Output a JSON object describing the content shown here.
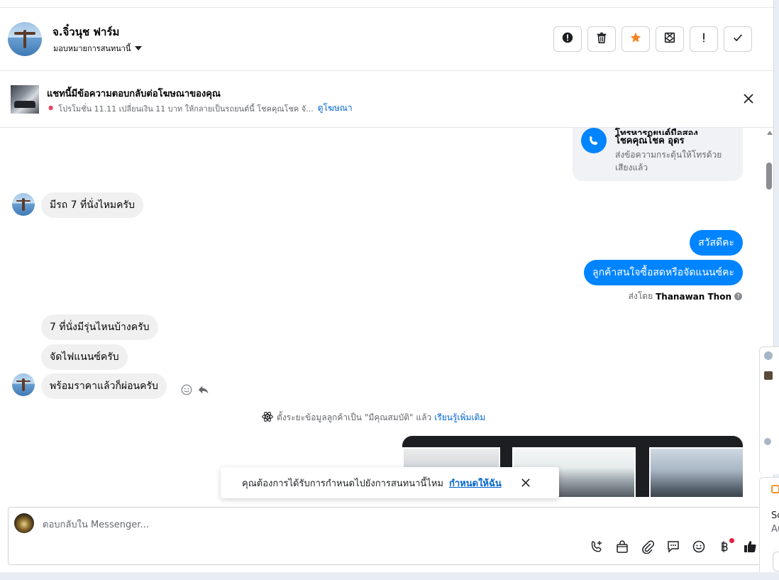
{
  "header": {
    "contact_name": "จ.จิ๋วนุช ฟาร์ม",
    "assign_label": "มอบหมายการสนทนานี้"
  },
  "ad_banner": {
    "title": "แชทนี้มีข้อความตอบกลับต่อโฆษณาของคุณ",
    "subtitle": "โปรโมชั่น 11.11 เปลี่ยนเงิน 11 บาท ให้กลายเป็นรถยนต์นี้ โชคคุณโชค จั...",
    "link": "ดูโฆษณา"
  },
  "call_card": {
    "title_line1": "โทรหารถยนต์มือสอง",
    "title_line2": "โชคคุณโชค อุดร",
    "description": "ส่งข้อความกระตุ้นให้โทรด้วยเสียงแล้ว"
  },
  "messages": {
    "in_1": "มีรถ 7 ที่นั่งไหมครับ",
    "out_1": "สวัสดีคะ",
    "out_2": "ลูกค้าสนใจซื้อสดหรือจัดแนนซ์คะ",
    "sent_by_label": "ส่งโดย",
    "sent_by_name": "Thanawan Thon",
    "in_2": "7 ที่นั่งมีรุ่นไหนบ้างครับ",
    "in_3": "จัดไฟแนนซ์ครับ",
    "in_4": "พร้อมราคาแล้วก็ผ่อนครับ"
  },
  "system_message": {
    "text": "ตั้งระยะข้อมูลลูกค้าเป็น \"มีคุณสมบัติ\" แล้ว",
    "link": "เรียนรู้เพิ่มเติม"
  },
  "toast": {
    "text": "คุณต้องการได้รับการกำหนดไปยังการสนทนานี้ไหม",
    "link": "กำหนดให้ฉัน"
  },
  "composer": {
    "placeholder": "ตอบกลับใน Messenger..."
  },
  "side_panel": {
    "line1": "So",
    "line2": "Au"
  },
  "icons": {
    "header_actions": [
      "alert-circle-icon",
      "trash-icon",
      "star-icon",
      "mark-unread-icon",
      "exclamation-icon",
      "check-icon"
    ],
    "composer_tools": [
      "phone-add-icon",
      "shop-bag-icon",
      "attachment-icon",
      "chat-bubble-icon",
      "emoji-icon",
      "baht-icon",
      "thumbs-up-icon"
    ]
  },
  "colors": {
    "accent": "#0084ff",
    "star": "#f5831f",
    "notification": "#e41e3f",
    "link": "#0064d1"
  }
}
